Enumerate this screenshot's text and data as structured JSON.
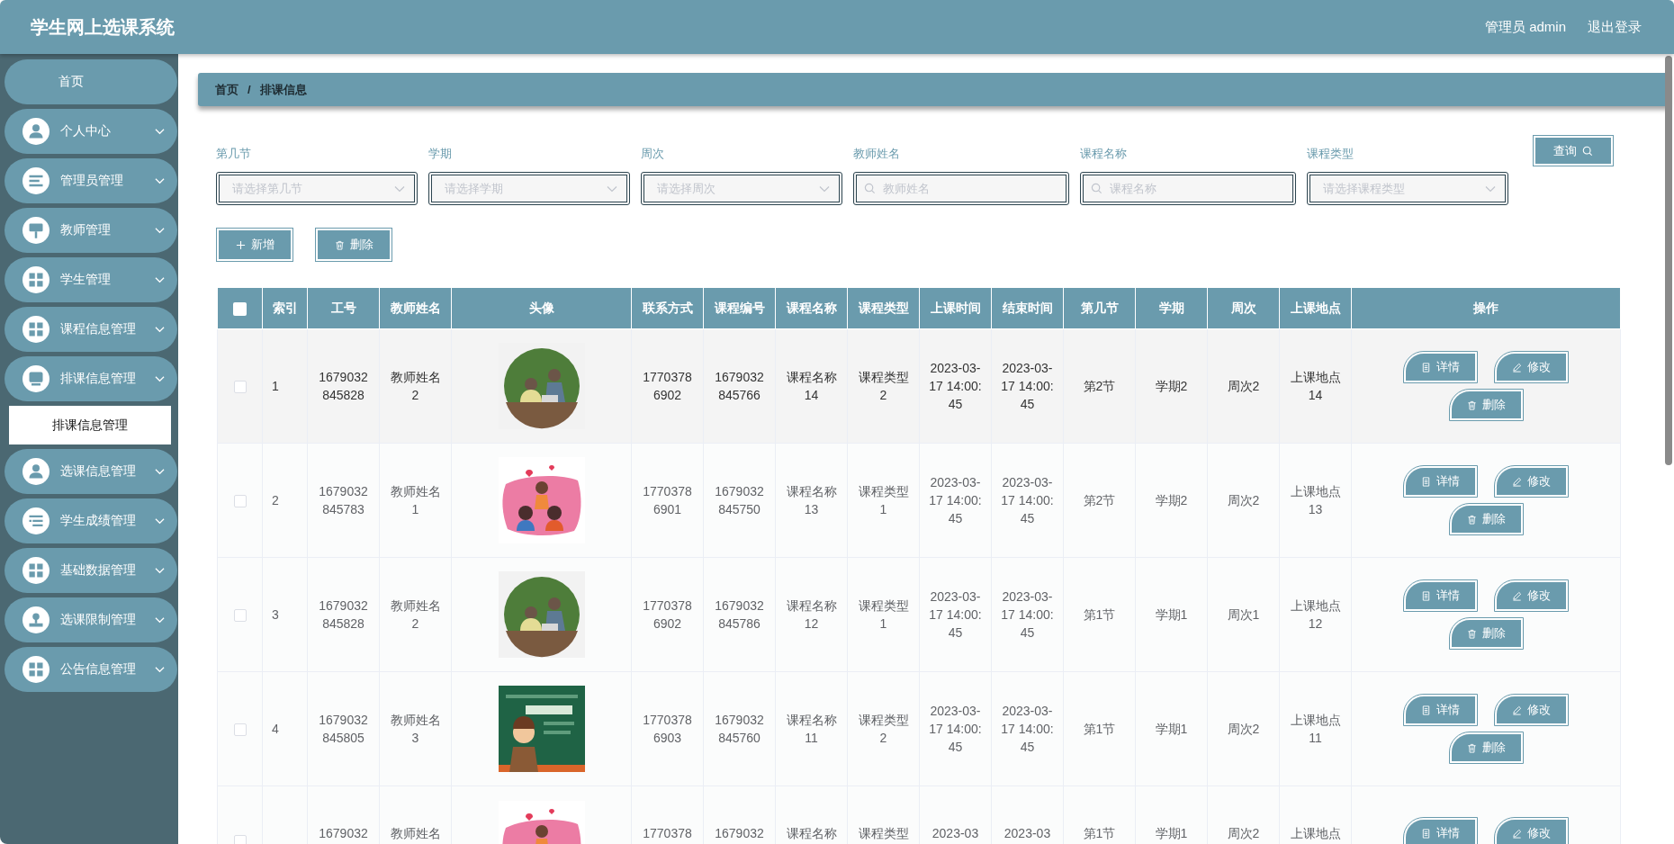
{
  "header": {
    "title": "学生网上选课系统",
    "user": "管理员 admin",
    "logout": "退出登录"
  },
  "sidebar": {
    "items": [
      {
        "kind": "link",
        "label": "首页"
      },
      {
        "kind": "menu",
        "label": "个人中心"
      },
      {
        "kind": "menu",
        "label": "管理员管理"
      },
      {
        "kind": "menu",
        "label": "教师管理"
      },
      {
        "kind": "menu",
        "label": "学生管理"
      },
      {
        "kind": "menu",
        "label": "课程信息管理"
      },
      {
        "kind": "menu",
        "label": "排课信息管理",
        "expanded": true,
        "children": [
          {
            "label": "排课信息管理",
            "selected": true
          }
        ]
      },
      {
        "kind": "menu",
        "label": "选课信息管理"
      },
      {
        "kind": "menu",
        "label": "学生成绩管理"
      },
      {
        "kind": "menu",
        "label": "基础数据管理"
      },
      {
        "kind": "menu",
        "label": "选课限制管理"
      },
      {
        "kind": "menu",
        "label": "公告信息管理"
      }
    ]
  },
  "breadcrumb": {
    "items": [
      "首页",
      "排课信息"
    ],
    "separator": "/"
  },
  "filters": [
    {
      "kind": "select",
      "label": "第几节",
      "placeholder": "请选择第几节"
    },
    {
      "kind": "select",
      "label": "学期",
      "placeholder": "请选择学期"
    },
    {
      "kind": "select",
      "label": "周次",
      "placeholder": "请选择周次"
    },
    {
      "kind": "search",
      "label": "教师姓名",
      "placeholder": "教师姓名"
    },
    {
      "kind": "search",
      "label": "课程名称",
      "placeholder": "课程名称"
    },
    {
      "kind": "select",
      "label": "课程类型",
      "placeholder": "请选择课程类型"
    }
  ],
  "query_button": "查询",
  "toolbar": [
    {
      "kind": "add",
      "label": "新增"
    },
    {
      "kind": "delete",
      "label": "删除"
    }
  ],
  "table": {
    "all_checked": false,
    "columns": [
      "索引",
      "工号",
      "教师姓名",
      "头像",
      "联系方式",
      "课程编号",
      "课程名称",
      "课程类型",
      "上课时间",
      "结束时间",
      "第几节",
      "学期",
      "周次",
      "上课地点",
      "操作"
    ],
    "rows": [
      {
        "checked": false,
        "index": "1",
        "staff_no": "1679032845828",
        "teacher": "教师姓名2",
        "phone": "17703786902",
        "course_no": "1679032845766",
        "course_name": "课程名称14",
        "course_type": "课程类型2",
        "start": "2023-03-17 14:00:45",
        "end": "2023-03-17 14:00:45",
        "period": "第2节",
        "term": "学期2",
        "week": "周次2",
        "location": "上课地点14",
        "actions": [
          {
            "kind": "detail",
            "label": "详情"
          },
          {
            "kind": "edit",
            "label": "修改"
          },
          {
            "kind": "delete",
            "label": "删除"
          }
        ]
      },
      {
        "checked": false,
        "index": "2",
        "staff_no": "1679032845783",
        "teacher": "教师姓名1",
        "phone": "17703786901",
        "course_no": "1679032845750",
        "course_name": "课程名称13",
        "course_type": "课程类型1",
        "start": "2023-03-17 14:00:45",
        "end": "2023-03-17 14:00:45",
        "period": "第2节",
        "term": "学期2",
        "week": "周次2",
        "location": "上课地点13",
        "actions": [
          {
            "kind": "detail",
            "label": "详情"
          },
          {
            "kind": "edit",
            "label": "修改"
          },
          {
            "kind": "delete",
            "label": "删除"
          }
        ]
      },
      {
        "checked": false,
        "index": "3",
        "staff_no": "1679032845828",
        "teacher": "教师姓名2",
        "phone": "17703786902",
        "course_no": "1679032845786",
        "course_name": "课程名称12",
        "course_type": "课程类型1",
        "start": "2023-03-17 14:00:45",
        "end": "2023-03-17 14:00:45",
        "period": "第1节",
        "term": "学期1",
        "week": "周次1",
        "location": "上课地点12",
        "actions": [
          {
            "kind": "detail",
            "label": "详情"
          },
          {
            "kind": "edit",
            "label": "修改"
          },
          {
            "kind": "delete",
            "label": "删除"
          }
        ]
      },
      {
        "checked": false,
        "index": "4",
        "staff_no": "1679032845805",
        "teacher": "教师姓名3",
        "phone": "17703786903",
        "course_no": "1679032845760",
        "course_name": "课程名称11",
        "course_type": "课程类型2",
        "start": "2023-03-17 14:00:45",
        "end": "2023-03-17 14:00:45",
        "period": "第1节",
        "term": "学期1",
        "week": "周次2",
        "location": "上课地点11",
        "actions": [
          {
            "kind": "detail",
            "label": "详情"
          },
          {
            "kind": "edit",
            "label": "修改"
          },
          {
            "kind": "delete",
            "label": "删除"
          }
        ]
      },
      {
        "checked": false,
        "staff_no": "1679032",
        "teacher": "教师姓名",
        "phone": "1770378",
        "course_no": "1679032",
        "course_name": "课程名称",
        "course_type": "课程类型",
        "start": "2023-03",
        "end": "2023-03",
        "period": "第1节",
        "term": "学期1",
        "week": "周次2",
        "location": "上课地点",
        "actions": [
          {
            "kind": "detail",
            "label": "详情"
          },
          {
            "kind": "edit",
            "label": "修改"
          }
        ]
      }
    ]
  }
}
